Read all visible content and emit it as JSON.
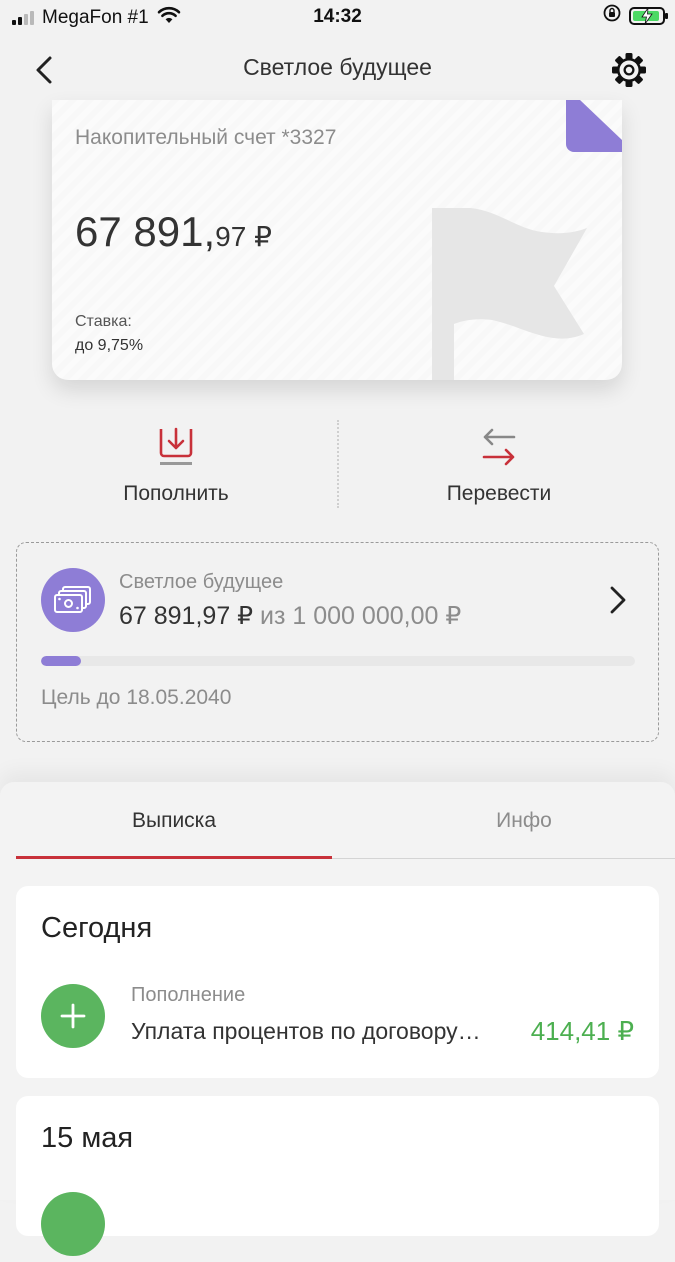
{
  "status_bar": {
    "carrier": "MegaFon #1",
    "time": "14:32",
    "icons": [
      "signal-icon",
      "wifi-icon",
      "rotation-lock-icon",
      "battery-charging-icon"
    ]
  },
  "nav": {
    "title": "Светлое будущее",
    "back_icon": "chevron-left-icon",
    "settings_icon": "gear-icon"
  },
  "account_card": {
    "title": "Накопительный счет *3327",
    "balance_int": "67 891,",
    "balance_frac": "97 ₽",
    "rate_label": "Ставка:",
    "rate_value": "до 9,75%",
    "corner_color": "#8e7dd6",
    "decor_icon": "flag-icon"
  },
  "actions": {
    "topup_label": "Пополнить",
    "topup_icon": "deposit-download-icon",
    "transfer_label": "Перевести",
    "transfer_icon": "transfer-arrows-icon"
  },
  "goal": {
    "name": "Светлое будущее",
    "amount": "67 891,97 ₽",
    "of_target": "из 1 000 000,00 ₽",
    "progress": 0.068,
    "date": "Цель до 18.05.2040",
    "accent": "#8e7dd6"
  },
  "tabs": [
    {
      "label": "Выписка",
      "active": true
    },
    {
      "label": "Инфо",
      "active": false
    }
  ],
  "statement": [
    {
      "date": "Сегодня",
      "transactions": [
        {
          "type": "Пополнение",
          "description": "Уплата процентов по договору…",
          "amount": "414,41 ₽"
        }
      ]
    },
    {
      "date": "15 мая"
    }
  ],
  "colors": {
    "brand_red": "#c8313a",
    "income_green": "#4caf50",
    "goal_purple": "#8e7dd6"
  }
}
